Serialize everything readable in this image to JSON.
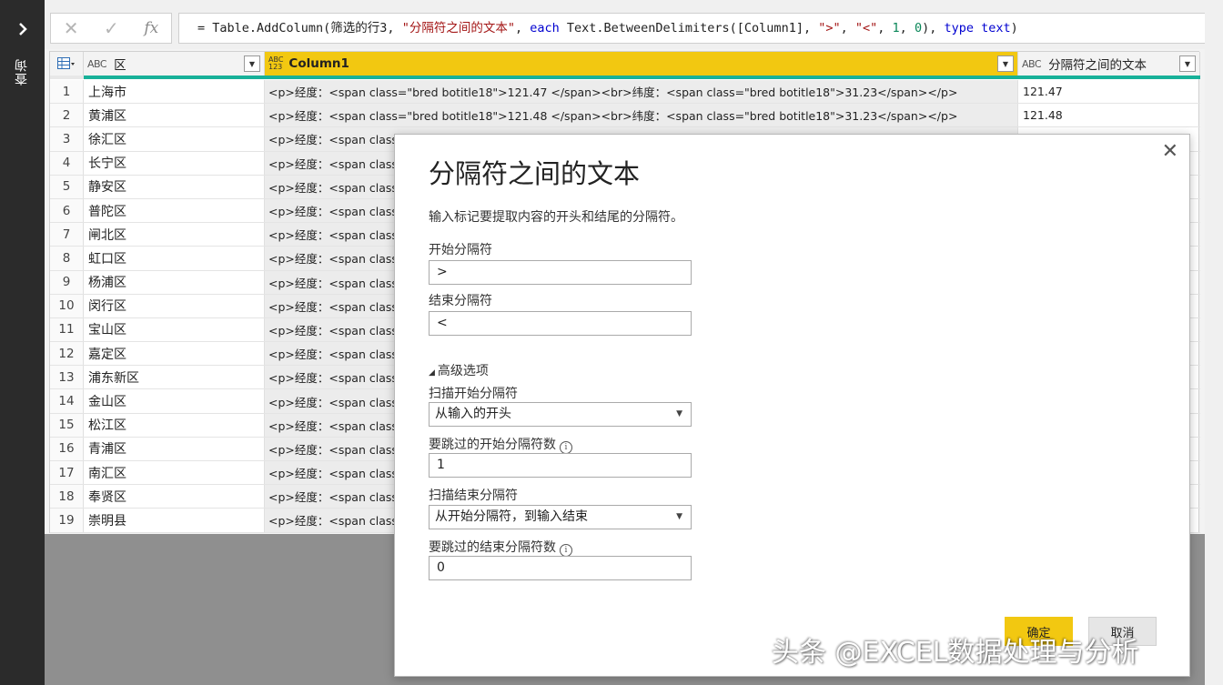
{
  "rail": {
    "label": "查询"
  },
  "formula": {
    "prefix": "= Table.AddColumn(筛选的行3, ",
    "str1": "\"分隔符之间的文本\"",
    "sep1": ", ",
    "kw_each": "each",
    "mid": " Text.BetweenDelimiters([Column1], ",
    "str2": "\">\"",
    "sep2": ", ",
    "str3": "\"<\"",
    "sep3": ", ",
    "num1": "1",
    "sep4": ", ",
    "num2": "0",
    "sep5": "), ",
    "kw_type": "type",
    "kw_text": "text",
    "suffix": ")"
  },
  "table": {
    "headers": {
      "qu": "区",
      "qu_type": "ABC",
      "col1": "Column1",
      "col1_type_top": "ABC",
      "col1_type_bottom": "123",
      "sep": "分隔符之间的文本",
      "sep_type": "ABC"
    },
    "rows": [
      {
        "idx": "1",
        "qu": "上海市",
        "col1": "<p>经度：<span class=\"bred botitle18\">121.47 </span><br>纬度：<span class=\"bred botitle18\">31.23</span></p>",
        "sep": "121.47"
      },
      {
        "idx": "2",
        "qu": "黄浦区",
        "col1": "<p>经度：<span class=\"bred botitle18\">121.48 </span><br>纬度：<span class=\"bred botitle18\">31.23</span></p>",
        "sep": "121.48"
      },
      {
        "idx": "3",
        "qu": "徐汇区",
        "col1": "<p>经度：<span class=",
        "sep": ""
      },
      {
        "idx": "4",
        "qu": "长宁区",
        "col1": "<p>经度：<span class=",
        "sep": ""
      },
      {
        "idx": "5",
        "qu": "静安区",
        "col1": "<p>经度：<span class=",
        "sep": ""
      },
      {
        "idx": "6",
        "qu": "普陀区",
        "col1": "<p>经度：<span class=",
        "sep": ""
      },
      {
        "idx": "7",
        "qu": "闸北区",
        "col1": "<p>经度：<span class=",
        "sep": ""
      },
      {
        "idx": "8",
        "qu": "虹口区",
        "col1": "<p>经度：<span class=",
        "sep": ""
      },
      {
        "idx": "9",
        "qu": "杨浦区",
        "col1": "<p>经度：<span class=",
        "sep": ""
      },
      {
        "idx": "10",
        "qu": "闵行区",
        "col1": "<p>经度：<span class=",
        "sep": ""
      },
      {
        "idx": "11",
        "qu": "宝山区",
        "col1": "<p>经度：<span class=",
        "sep": ""
      },
      {
        "idx": "12",
        "qu": "嘉定区",
        "col1": "<p>经度：<span class=",
        "sep": ""
      },
      {
        "idx": "13",
        "qu": "浦东新区",
        "col1": "<p>经度：<span class=",
        "sep": ""
      },
      {
        "idx": "14",
        "qu": "金山区",
        "col1": "<p>经度：<span class=",
        "sep": ""
      },
      {
        "idx": "15",
        "qu": "松江区",
        "col1": "<p>经度：<span class=",
        "sep": ""
      },
      {
        "idx": "16",
        "qu": "青浦区",
        "col1": "<p>经度：<span class=",
        "sep": ""
      },
      {
        "idx": "17",
        "qu": "南汇区",
        "col1": "<p>经度：<span class=",
        "sep": ""
      },
      {
        "idx": "18",
        "qu": "奉贤区",
        "col1": "<p>经度：<span class=",
        "sep": ""
      },
      {
        "idx": "19",
        "qu": "崇明县",
        "col1": "<p>经度：<span class=",
        "sep": ""
      }
    ]
  },
  "dialog": {
    "title": "分隔符之间的文本",
    "description": "输入标记要提取内容的开头和结尾的分隔符。",
    "start_label": "开始分隔符",
    "start_value": ">",
    "end_label": "结束分隔符",
    "end_value": "<",
    "advanced_label": "高级选项",
    "scan_start_label": "扫描开始分隔符",
    "scan_start_value": "从输入的开头",
    "skip_start_label": "要跳过的开始分隔符数",
    "skip_start_value": "1",
    "scan_end_label": "扫描结束分隔符",
    "scan_end_value": "从开始分隔符，到输入结束",
    "skip_end_label": "要跳过的结束分隔符数",
    "skip_end_value": "0",
    "ok_label": "确定",
    "cancel_label": "取消"
  },
  "watermark": "头条 @EXCEL数据处理与分析",
  "colors": {
    "accent": "#f2c811",
    "teal": "#18b199",
    "rail": "#2b2b2b"
  }
}
